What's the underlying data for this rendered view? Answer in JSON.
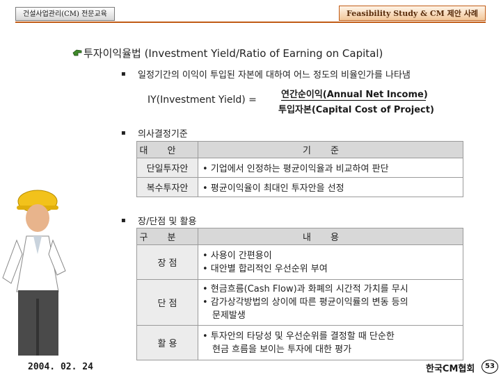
{
  "header": {
    "left_tag": "건설사업관리(CM) 전문교육",
    "right_tag": "Feasibility Study & CM 제안 사례"
  },
  "heading": "투자이익율법 (Investment Yield/Ratio of Earning on Capital)",
  "bullets": [
    "일정기간의 이익이 투입된 자본에 대하여 어느 정도의 비율인가를 나타냄",
    "의사결정기준",
    "장/단점 및 활용"
  ],
  "formula": {
    "left": "IY(Investment Yield) =",
    "numerator": "연간순이익(Annual Net Income)",
    "denominator": "투입자본(Capital Cost of Project)"
  },
  "decision_table": {
    "headers": [
      "대안",
      "기준"
    ],
    "rows": [
      {
        "label": "단일투자안",
        "text": "• 기업에서 인정하는 평균이익율과 비교하여 판단"
      },
      {
        "label": "복수투자안",
        "text": "• 평균이익율이 최대인 투자안을 선정"
      }
    ]
  },
  "pros_cons_table": {
    "headers": [
      "구분",
      "내용"
    ],
    "rows": [
      {
        "label": "장 점",
        "lines": [
          "• 사용이 간편용이",
          "• 대안별 합리적인 우선순위 부여"
        ]
      },
      {
        "label": "단 점",
        "lines": [
          "• 현금흐름(Cash Flow)과 화폐의 시간적 가치를 무시",
          "• 감가상각방법의 상이에 따른 평균이익률의 변동 등의",
          "문제발생"
        ]
      },
      {
        "label": "활 용",
        "lines": [
          "• 투자안의 타당성 및 우선순위를 결정할 때 단순한",
          "현금 흐름을 보이는 투자에 대한 평가"
        ]
      }
    ]
  },
  "footer": {
    "date": "2004. 02. 24",
    "org": "한국CM협회",
    "page": "53"
  },
  "colors": {
    "accent": "#c05a14",
    "table_header": "#d8d8d8"
  }
}
